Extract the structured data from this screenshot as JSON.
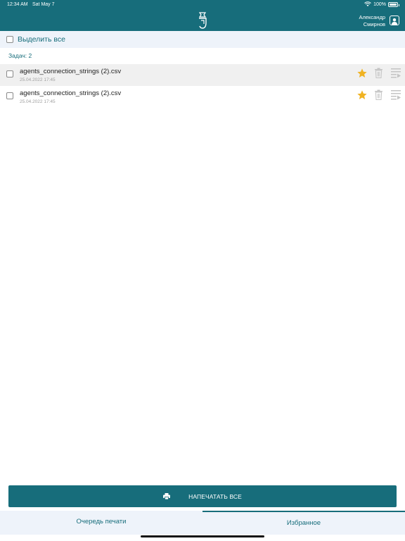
{
  "status_bar": {
    "time": "12:34 AM",
    "date": "Sat May 7",
    "battery": "100%"
  },
  "header": {
    "user_name_line1": "Александр",
    "user_name_line2": "Смирнов"
  },
  "select_all": {
    "label": "Выделить все"
  },
  "task_count": "Задач: 2",
  "files": [
    {
      "name": "agents_connection_strings (2).csv",
      "date": "25.04.2022 17:45"
    },
    {
      "name": "agents_connection_strings (2).csv",
      "date": "25.04.2022 17:45"
    }
  ],
  "print_all": {
    "label": "НАПЕЧАТАТЬ ВСЕ"
  },
  "tabs": [
    {
      "label": "Очередь печати"
    },
    {
      "label": "Избранное"
    }
  ],
  "colors": {
    "primary": "#176d7b",
    "star": "#f0b323",
    "icon_gray": "#c4c4c4"
  }
}
